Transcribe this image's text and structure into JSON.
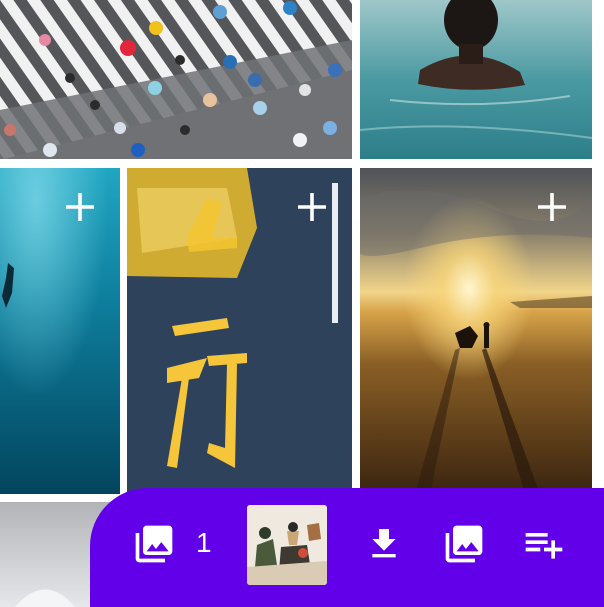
{
  "gallery": {
    "photos": [
      {
        "name": "crosswalk-umbrellas-photo",
        "theme": "crowd crossing with umbrellas"
      },
      {
        "name": "swimmer-in-sea-photo",
        "theme": "person in turquoise water"
      },
      {
        "name": "underwater-diver-photo",
        "theme": "diver under blue water"
      },
      {
        "name": "taxi-road-marking-photo",
        "theme": "yellow taxi over road characters"
      },
      {
        "name": "beach-sunset-silhouette-photo",
        "theme": "sunset beach silhouettes"
      },
      {
        "name": "cloudy-sky-photo",
        "theme": "pale sky"
      }
    ],
    "add_icon": "plus-icon"
  },
  "selection_bar": {
    "selected_count": "1",
    "icons": {
      "gallery": "photo-library-icon",
      "download": "download-icon",
      "collection": "photo-library-icon",
      "queue": "playlist-add-icon"
    },
    "colors": {
      "bar_background": "#6200ea",
      "icon": "#ffffff"
    }
  }
}
